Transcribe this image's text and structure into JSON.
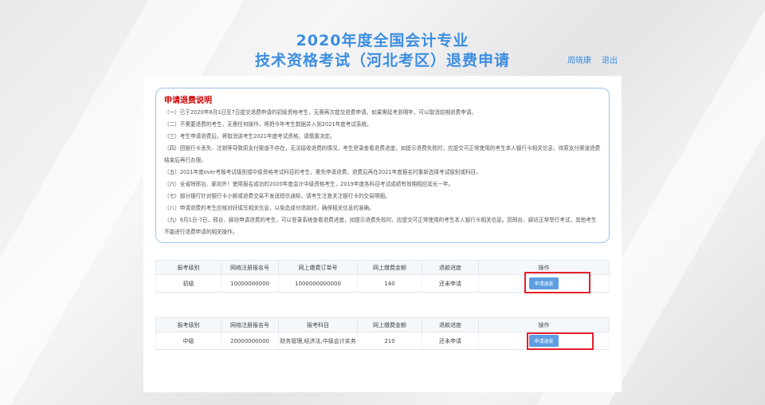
{
  "header": {
    "title_line1": "2020年度全国会计专业",
    "title_line2": "技术资格考试（河北考区）退费申请",
    "user_name": "周晓康",
    "logout": "退出"
  },
  "notice": {
    "heading": "申请退费说明",
    "items": [
      "（一）已于2020年8月1日至7日提交退费申请的初级资格考生，无需再次提交退费申请。如果需延考到明年，可以取消前期退费申请。",
      "（二）不需要退费的考生，无需任何操作，将把今年考生数据并入到2021年度考试系统。",
      "（三）考生申请退费后，将取消该考生2021年度考试资格，请慎重决定。",
      "（四）因银行卡丢失、注销等导致原支付渠道不存在，无法接收退费的情况，考生登录查看退费进度，如提示退费失败时，应提交可正常使用的考生本人银行卡相关信息，待原支付渠道退费结束后再行办理。",
      "（五）2021年度over考报考试级别或中级资格考试科目的考生，需先申请退费，退费后再在2021年度报名时重新选择考试级别或科目。",
      "（六）全省除邢台、廊坊外！使用报名成功的2020年度会计中级资格考生，2019年度各科目考试成绩有效期相应延长一年。",
      "（七）部分银行针对银行卡小额或退费交易不发送短信通知，请考生注意关注银行卡的交易明细。",
      "（八）申请退费的考生应核对好填写相关信息，以免造成付退款时，确保相关信息的准确。",
      "（九）8月1日-7日，邢台、廊坊申请退费的考生，可以登录系统查看退费进度，如提示退费失败时，应提交可正常使用的考生本人银行卡相关信息。因邢台、廊坊正常举行考试，其他考生不能进行退费申请的相关操作。"
    ]
  },
  "table1": {
    "headers": [
      "报考级别",
      "网络注册报名号",
      "网上缴费订单号",
      "网上缴费金额",
      "退款进度",
      "操作"
    ],
    "rows": [
      {
        "level": "初级",
        "reg_no": "10000000000",
        "order_no": "1000000000000",
        "amount": "140",
        "status": "还未申请",
        "action": "申请退款"
      }
    ]
  },
  "table2": {
    "headers": [
      "报考级别",
      "网络注册报名号",
      "报考科目",
      "网上缴费金额",
      "退款进度",
      "操作"
    ],
    "rows": [
      {
        "level": "中级",
        "reg_no": "20000000000",
        "subjects": "财务管理,经济法,中级会计实务",
        "amount": "210",
        "status": "还未申请",
        "action": "申请退款"
      }
    ]
  }
}
